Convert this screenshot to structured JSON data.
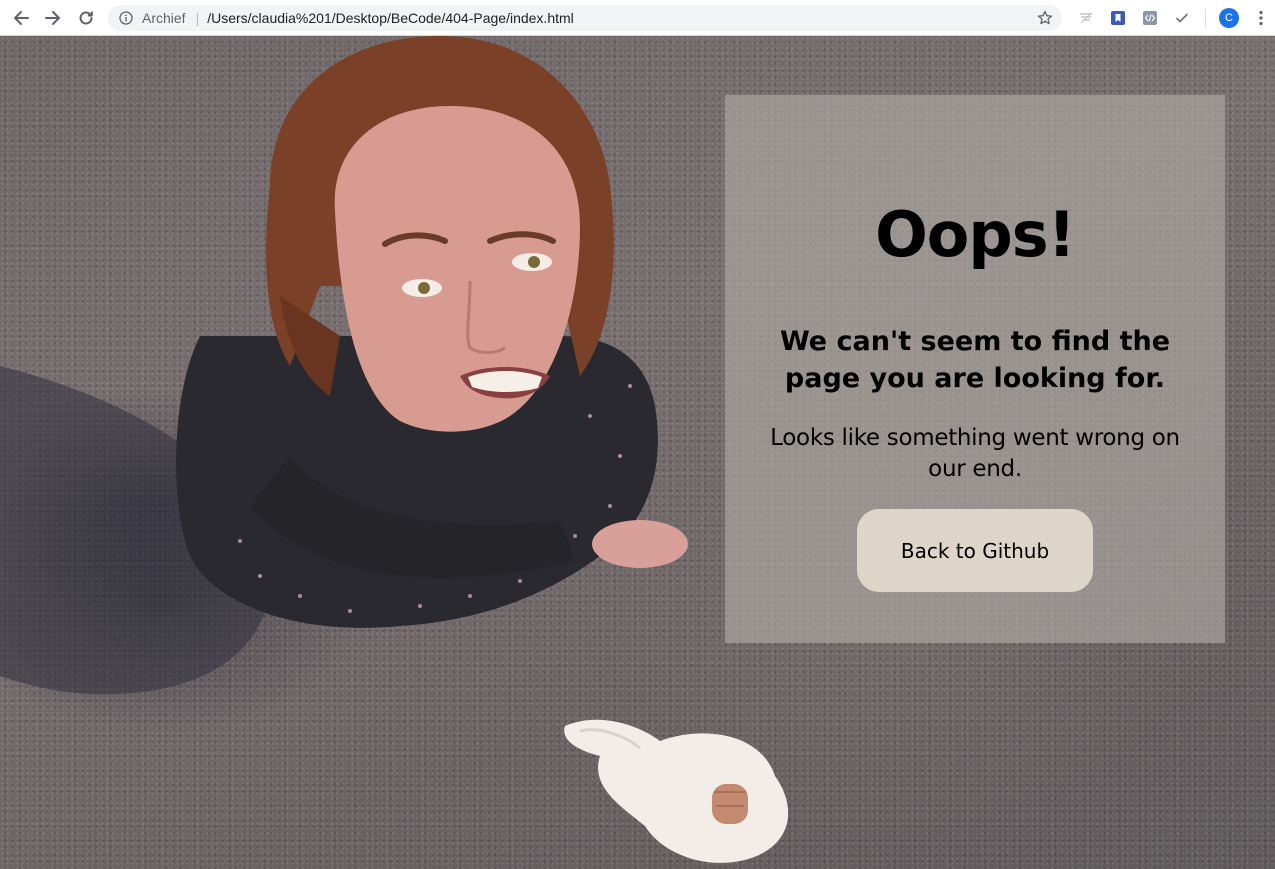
{
  "browser": {
    "site_info_label": "Archief",
    "url": "/Users/claudia%201/Desktop/BeCode/404-Page/index.html",
    "profile_initial": "C",
    "icons": [
      "back-arrow-icon",
      "forward-arrow-icon",
      "reload-icon",
      "info-icon",
      "star-icon",
      "extension-icon",
      "bookmark-icon",
      "code-icon",
      "checkmark-icon",
      "menu-dots-icon"
    ]
  },
  "card": {
    "title": "Oops!",
    "subtitle": "We can't seem to find the page you are looking for.",
    "message": "Looks like something went wrong on our end.",
    "button_label": "Back to Github"
  }
}
